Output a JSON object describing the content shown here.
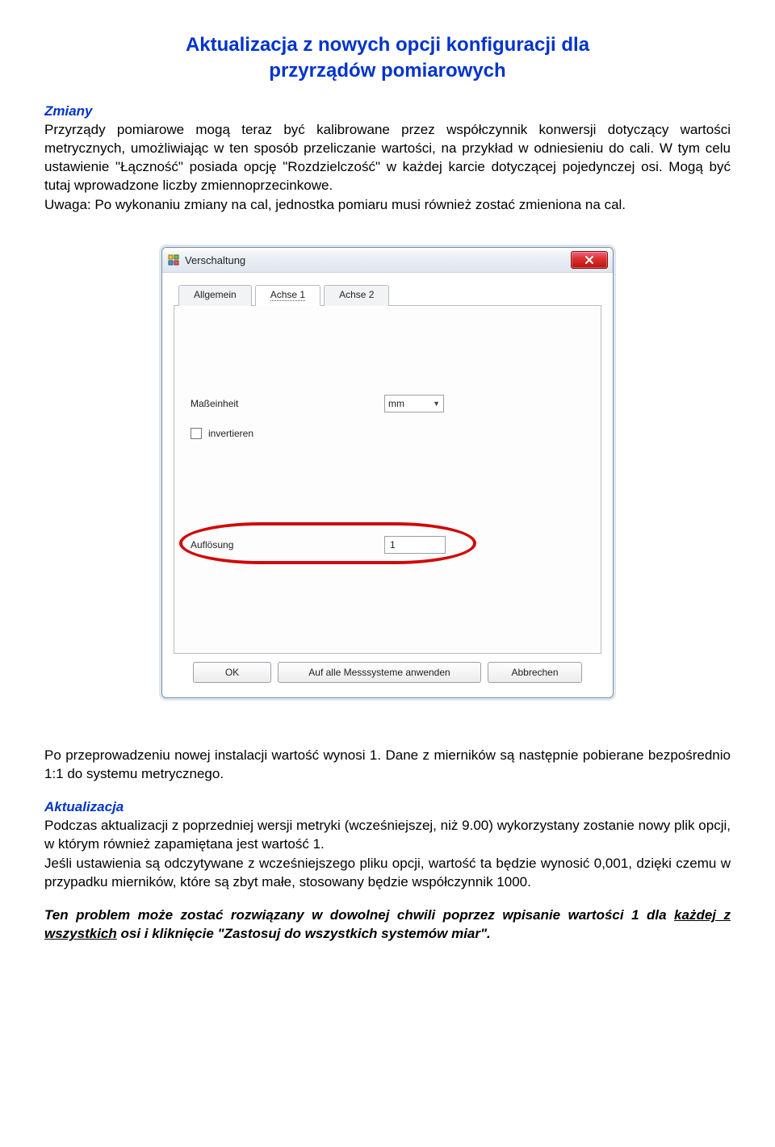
{
  "title_line1": "Aktualizacja z nowych opcji konfiguracji dla",
  "title_line2": "przyrządów pomiarowych",
  "section1_heading": "Zmiany",
  "para1": "Przyrządy pomiarowe mogą teraz być kalibrowane przez współczynnik konwersji dotyczący wartości metrycznych, umożliwiając w ten sposób przeliczanie wartości, na przykład w odniesieniu do cali. W tym celu ustawienie \"Łączność\" posiada opcję \"Rozdzielczość\" w każdej karcie dotyczącej pojedynczej osi. Mogą być tutaj wprowadzone liczby zmiennoprzecinkowe.",
  "para1b": "Uwaga: Po wykonaniu zmiany na cal, jednostka pomiaru musi również zostać zmieniona na cal.",
  "dialog": {
    "title": "Verschaltung",
    "tabs": [
      "Allgemein",
      "Achse 1",
      "Achse 2"
    ],
    "active_tab_index": 1,
    "unit_label": "Maßeinheit",
    "unit_value": "mm",
    "invert_label": "invertieren",
    "resolution_label": "Auflösung",
    "resolution_value": "1",
    "buttons": {
      "ok": "OK",
      "apply": "Auf alle Messsysteme anwenden",
      "cancel": "Abbrechen"
    }
  },
  "para2": "Po przeprowadzeniu nowej instalacji wartość wynosi 1. Dane z mierników są następnie pobierane bezpośrednio 1:1 do systemu metrycznego.",
  "section2_heading": "Aktualizacja",
  "para3": "Podczas aktualizacji z poprzedniej wersji metryki (wcześniejszej, niż 9.00) wykorzystany zostanie nowy plik opcji, w którym również zapamiętana jest wartość 1.",
  "para4": "Jeśli ustawienia są odczytywane z wcześniejszego pliku opcji, wartość ta będzie wynosić 0,001, dzięki czemu w przypadku mierników, które są zbyt małe, stosowany będzie współczynnik 1000.",
  "para5_pre": "Ten problem może zostać rozwiązany w dowolnej chwili poprzez wpisanie wartości 1 dla ",
  "para5_underlined": "każdej z wszystkich",
  "para5_post": " osi i kliknięcie \"Zastosuj do wszystkich systemów miar\"."
}
